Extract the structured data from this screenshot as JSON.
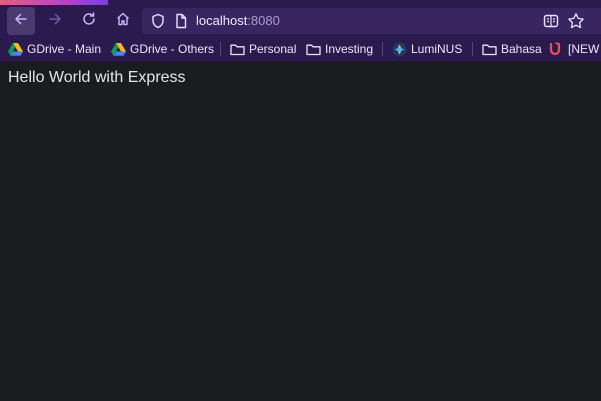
{
  "browser": {
    "url_host": "localhost",
    "url_port": ":8080",
    "icons": {
      "back": "arrow-left-icon",
      "forward": "arrow-right-icon",
      "reload": "reload-icon",
      "home": "home-icon",
      "shield": "shield-icon",
      "page": "page-icon",
      "reader": "reader-view-icon",
      "bookmark_star": "star-icon"
    },
    "colors": {
      "toolbar": "#2b1a4d",
      "urlbar": "#3a2563",
      "accent_start": "#e0607e",
      "accent_end": "#7b3fe0",
      "content_bg": "#1b1c1e"
    }
  },
  "bookmarks": [
    {
      "label": "GDrive - Main",
      "icon": "google-drive-icon"
    },
    {
      "label": "GDrive - Others",
      "icon": "google-drive-icon"
    },
    {
      "label": "Personal",
      "icon": "folder-icon"
    },
    {
      "label": "Investing",
      "icon": "folder-icon"
    },
    {
      "label": "LumiNUS",
      "icon": "luminus-icon"
    },
    {
      "label": "Bahasa",
      "icon": "folder-icon"
    },
    {
      "label": "[NEW",
      "icon": "udemy-icon"
    }
  ],
  "page": {
    "text": "Hello World with Express"
  }
}
